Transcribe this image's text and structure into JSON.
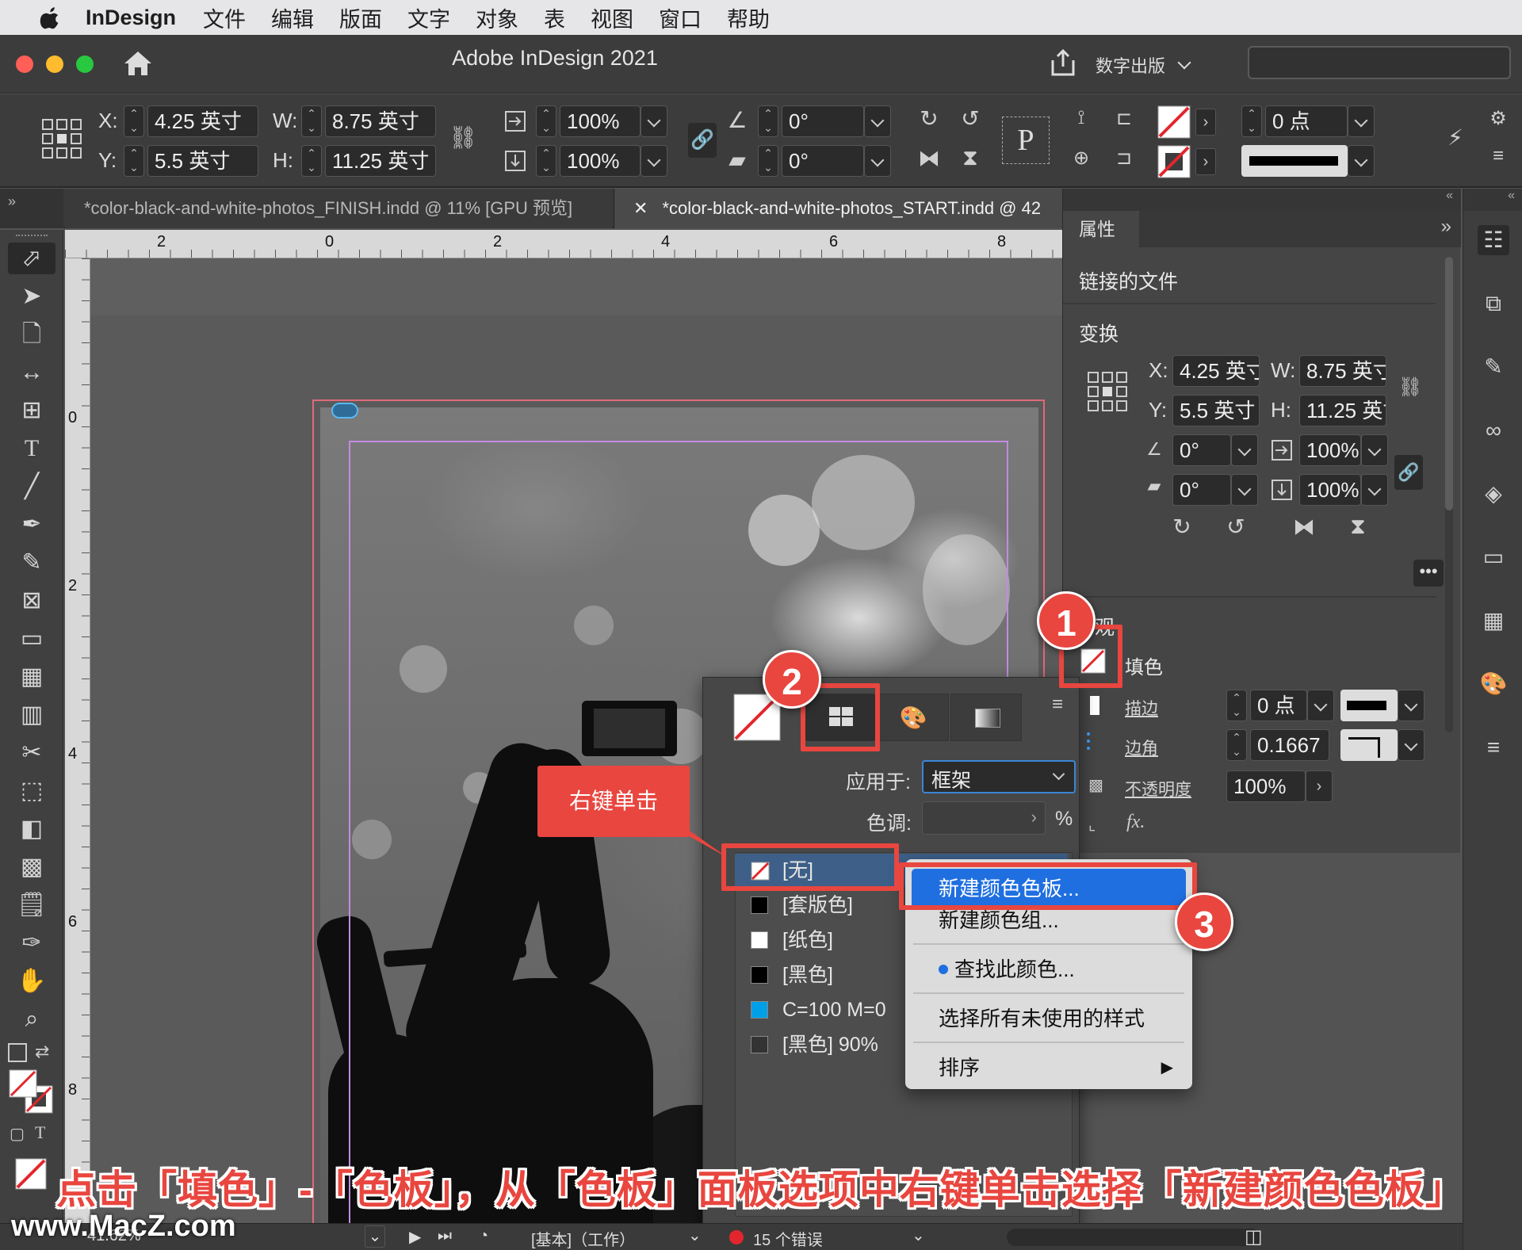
{
  "menubar": {
    "app": "InDesign",
    "items": [
      "文件",
      "编辑",
      "版面",
      "文字",
      "对象",
      "表",
      "视图",
      "窗口",
      "帮助"
    ]
  },
  "window": {
    "title": "Adobe InDesign 2021",
    "workspace": "数字出版"
  },
  "control": {
    "x_label": "X:",
    "x_value": "4.25 英寸",
    "y_label": "Y:",
    "y_value": "5.5 英寸",
    "w_label": "W:",
    "w_value": "8.75 英寸",
    "h_label": "H:",
    "h_value": "11.25 英寸",
    "scale_x": "100%",
    "scale_y": "100%",
    "rotate": "0°",
    "shear": "0°",
    "stroke_weight": "0 点"
  },
  "tabs": [
    {
      "label": "*color-black-and-white-photos_FINISH.indd @ 11% [GPU 预览]"
    },
    {
      "label": "*color-black-and-white-photos_START.indd @ 42"
    }
  ],
  "ruler": {
    "h_ticks": [
      "2",
      "0",
      "2",
      "4",
      "6",
      "8"
    ],
    "v_ticks": [
      "0",
      "2",
      "4",
      "6",
      "8"
    ]
  },
  "properties": {
    "tab_label": "属性",
    "linked_files": "链接的文件",
    "transform": "变换",
    "x_label": "X:",
    "x_value": "4.25 英寸",
    "y_label": "Y:",
    "y_value": "5.5 英寸",
    "w_label": "W:",
    "w_value": "8.75 英寸",
    "h_label": "H:",
    "h_value": "11.25 英寸",
    "rotate": "0°",
    "shear": "0°",
    "scale_x": "100%",
    "scale_y": "100%",
    "appearance_partial": "观",
    "fill_label": "填色",
    "stroke_label": "描边",
    "stroke_value": "0 点",
    "corner_label": "边角",
    "corner_value": "0.1667",
    "opacity_label": "不透明度",
    "opacity_value": "100%",
    "fx": "fx."
  },
  "swatches_popup": {
    "apply_to_label": "应用于:",
    "apply_to_value": "框架",
    "tint_label": "色调:",
    "tint_unit": "%",
    "rows": [
      {
        "name": "[无]",
        "color": "none"
      },
      {
        "name": "[套版色]",
        "color": "#000000"
      },
      {
        "name": "[纸色]",
        "color": "#ffffff"
      },
      {
        "name": "[黑色]",
        "color": "#000000"
      },
      {
        "name": "C=100 M=0",
        "color": "#00a0e8"
      },
      {
        "name": "[黑色] 90%",
        "color": "#333333"
      }
    ]
  },
  "context_menu": {
    "items": [
      {
        "label": "新建颜色色板...",
        "highlighted": true
      },
      {
        "label": "新建颜色组..."
      },
      {
        "label": "查找此颜色..."
      },
      {
        "label": "选择所有未使用的样式"
      },
      {
        "label": "排序",
        "submenu": true
      }
    ]
  },
  "annotations": {
    "callout": "右键单击",
    "badges": [
      "1",
      "2",
      "3"
    ],
    "caption": "点击「填色」-「色板」，从「色板」面板选项中右键单击选择「新建颜色色板」",
    "accent": "#e8463f"
  },
  "status": {
    "zoom": "41.62%",
    "style": "[基本]（工作）",
    "errors": "15 个错误",
    "watermark": "www.MacZ.com"
  }
}
